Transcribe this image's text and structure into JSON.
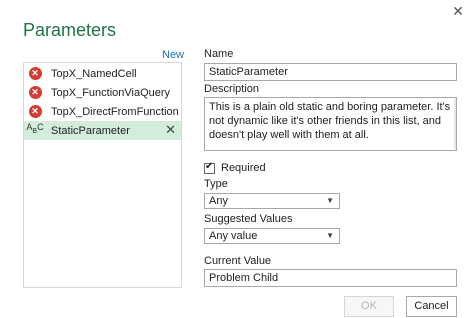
{
  "dialog": {
    "title": "Parameters",
    "close_icon": "close-icon",
    "close_glyph": "✕"
  },
  "list": {
    "new_label": "New",
    "items": [
      {
        "label": "TopX_NamedCell",
        "icon": "error-icon",
        "icon_glyph": "✕",
        "selected": false
      },
      {
        "label": "TopX_FunctionViaQuery",
        "icon": "error-icon",
        "icon_glyph": "✕",
        "selected": false
      },
      {
        "label": "TopX_DirectFromFunction",
        "icon": "error-icon",
        "icon_glyph": "✕",
        "selected": false
      },
      {
        "label": "StaticParameter",
        "icon": "text-type-icon",
        "icon_glyph_main": "A",
        "icon_glyph_sub": "B",
        "icon_glyph_tail": "C",
        "selected": true,
        "remove_glyph": "✕"
      }
    ]
  },
  "form": {
    "name_label": "Name",
    "name_value": "StaticParameter",
    "description_label": "Description",
    "description_value": "This is a plain old static and boring parameter.  It's not dynamic like it's other friends in this list, and doesn't play well with them at all.",
    "required_label": "Required",
    "required_checked": true,
    "required_tick": "✔",
    "type_label": "Type",
    "type_value": "Any",
    "suggested_label": "Suggested Values",
    "suggested_value": "Any value",
    "current_label": "Current Value",
    "current_value": "Problem Child",
    "dropdown_glyph": "▼"
  },
  "buttons": {
    "ok_label": "OK",
    "ok_enabled": false,
    "cancel_label": "Cancel"
  },
  "colors": {
    "title": "#217346",
    "link": "#1f6fb2",
    "selected_row": "#d3ecdc",
    "error_icon": "#d23c32"
  }
}
